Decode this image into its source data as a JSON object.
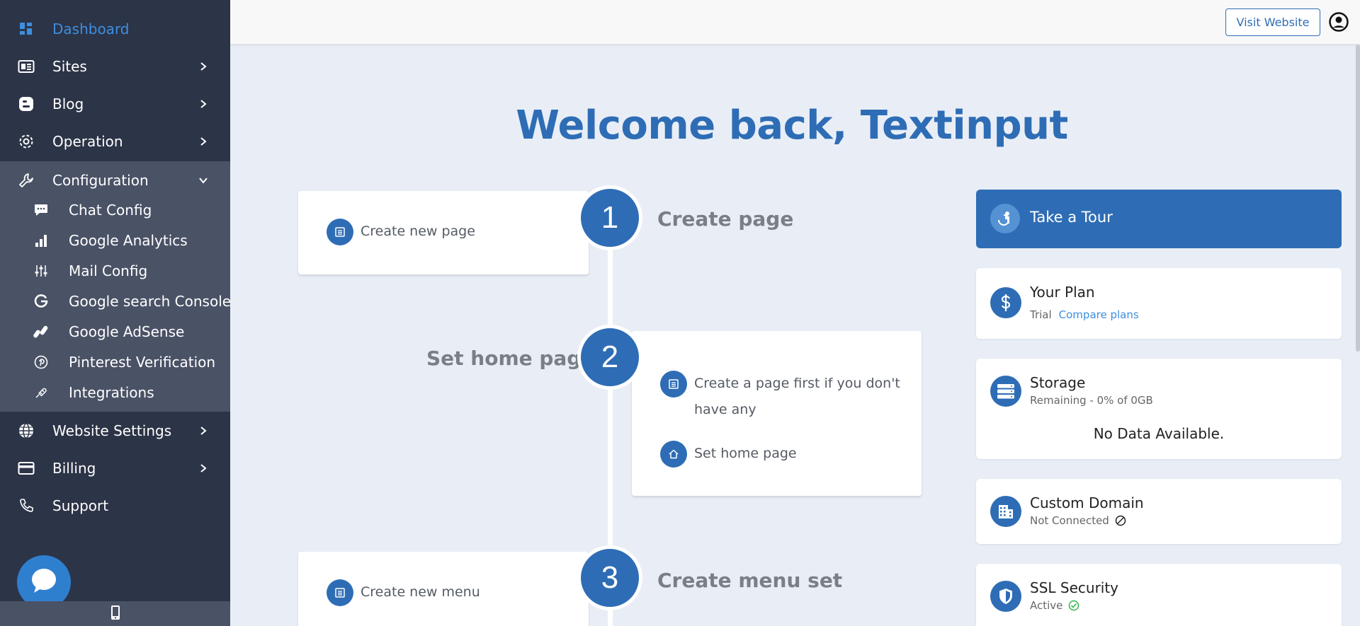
{
  "sidebar": {
    "items": [
      {
        "label": "Dashboard",
        "icon": "dashboard-icon"
      },
      {
        "label": "Sites",
        "icon": "sites-icon"
      },
      {
        "label": "Blog",
        "icon": "blog-icon"
      },
      {
        "label": "Operation",
        "icon": "gear-icon"
      },
      {
        "label": "Configuration",
        "icon": "wrench-icon"
      }
    ],
    "config_sub": [
      {
        "label": "Chat Config",
        "icon": "chat-icon"
      },
      {
        "label": "Google Analytics",
        "icon": "bar-chart-icon"
      },
      {
        "label": "Mail Config",
        "icon": "sliders-icon"
      },
      {
        "label": "Google search Console",
        "icon": "google-icon"
      },
      {
        "label": "Google AdSense",
        "icon": "adsense-icon"
      },
      {
        "label": "Pinterest Verification",
        "icon": "pinterest-icon"
      },
      {
        "label": "Integrations",
        "icon": "plug-icon"
      }
    ],
    "bottom_items": [
      {
        "label": "Website Settings",
        "icon": "globe-icon"
      },
      {
        "label": "Billing",
        "icon": "credit-card-icon"
      },
      {
        "label": "Support",
        "icon": "phone-icon"
      }
    ]
  },
  "topbar": {
    "visit_label": "Visit Website"
  },
  "main": {
    "welcome": "Welcome back, Textinput",
    "steps": [
      {
        "number": "1",
        "title": "Create page",
        "actions": [
          "Create new page"
        ]
      },
      {
        "number": "2",
        "title": "Set home page",
        "actions": [
          "Create a page first if you don't have any",
          "Set home page"
        ]
      },
      {
        "number": "3",
        "title": "Create menu set",
        "actions": [
          "Create new menu"
        ]
      }
    ]
  },
  "right": {
    "tour_label": "Take a Tour",
    "plan": {
      "title": "Your Plan",
      "tier": "Trial",
      "link": "Compare plans"
    },
    "storage": {
      "title": "Storage",
      "sub": "Remaining - 0% of 0GB",
      "empty": "No Data Available."
    },
    "domain": {
      "title": "Custom Domain",
      "status": "Not Connected"
    },
    "ssl": {
      "title": "SSL Security",
      "status": "Active"
    }
  },
  "colors": {
    "accent": "#2e6db5",
    "sidebar_bg": "#2c3447",
    "sub_bg": "#4a5266",
    "link": "#3d8fe0",
    "success": "#2eb84e"
  }
}
